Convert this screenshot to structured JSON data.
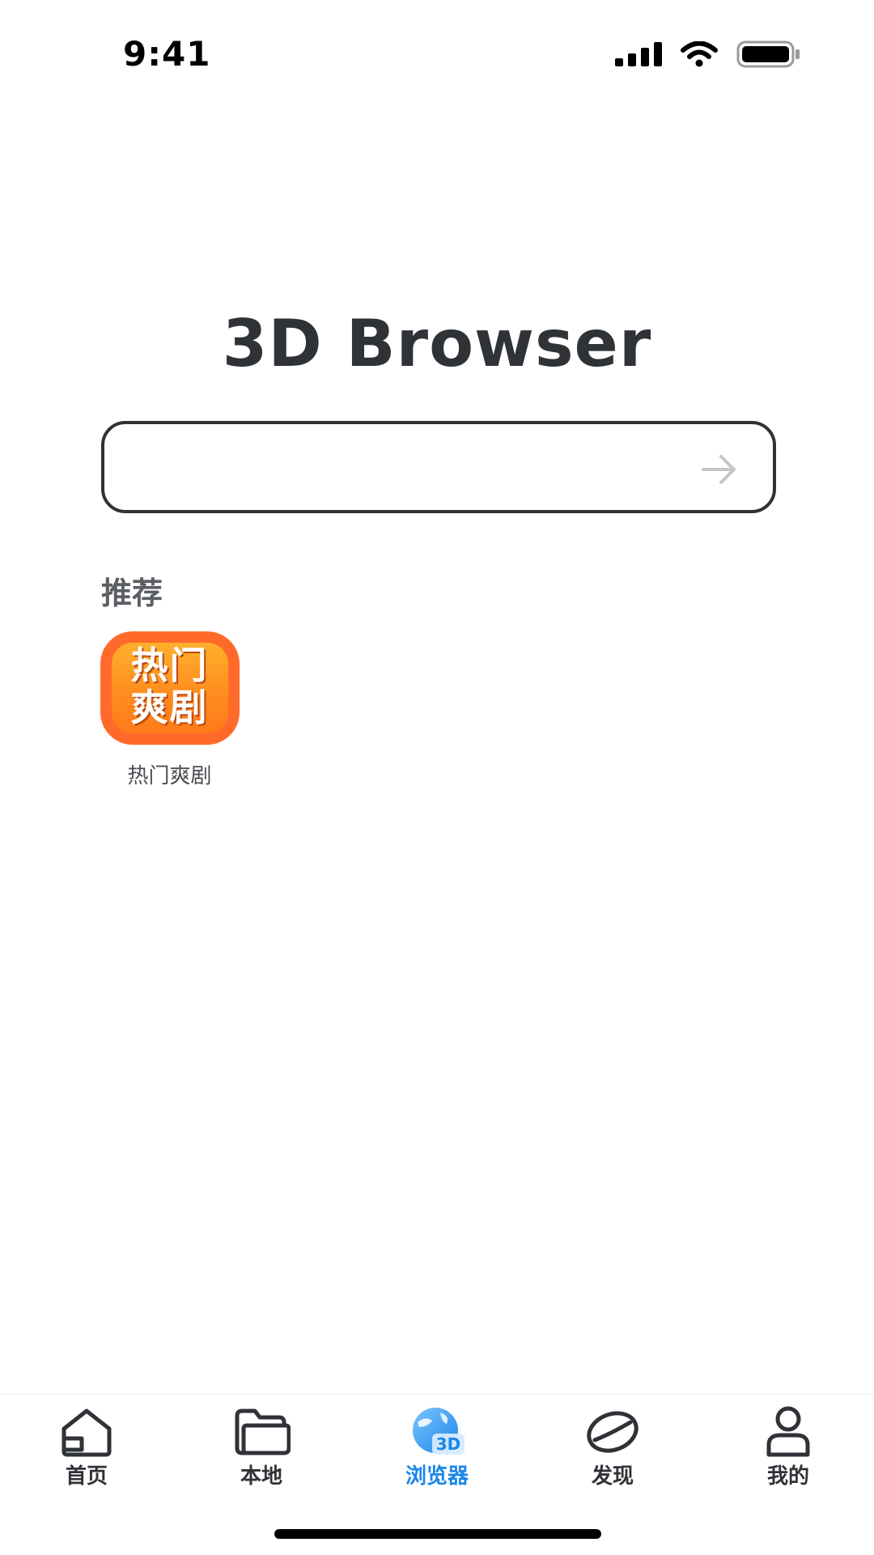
{
  "status_bar": {
    "time": "9:41"
  },
  "header": {
    "title": "3D Browser"
  },
  "search": {
    "value": "",
    "placeholder": "",
    "submit_icon": "arrow-right-icon"
  },
  "recommend": {
    "section_title": "推荐",
    "items": [
      {
        "label": "热门爽剧",
        "icon_text_line1": "热门",
        "icon_text_line2": "爽剧"
      }
    ]
  },
  "tab_bar": {
    "active_color": "#1b86e8",
    "items": [
      {
        "label": "首页",
        "icon": "home-icon",
        "active": false
      },
      {
        "label": "本地",
        "icon": "folder-icon",
        "active": false
      },
      {
        "label": "浏览器",
        "icon": "browser-3d-icon",
        "active": true
      },
      {
        "label": "发现",
        "icon": "planet-icon",
        "active": false
      },
      {
        "label": "我的",
        "icon": "user-icon",
        "active": false
      }
    ]
  }
}
